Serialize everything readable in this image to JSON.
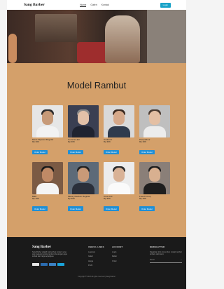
{
  "navbar": {
    "brand": "Sang Barber",
    "links": [
      "Home",
      "Galeri",
      "Kontak"
    ],
    "cta": "Login"
  },
  "models": {
    "title": "Model Rambut",
    "items": [
      {
        "name": "Mens Tapered Regular",
        "price": "Rp.30K",
        "button": "Order Model"
      },
      {
        "name": "Comma Hair",
        "price": "Rp.30K",
        "button": "Order Model"
      },
      {
        "name": "Undercut",
        "price": "Rp.30K",
        "button": "Order Model"
      },
      {
        "name": "Pompadour",
        "price": "Rp.30K",
        "button": "Order Model"
      },
      {
        "name": "Bald",
        "price": "Rp.30K",
        "button": "Order Model"
      },
      {
        "name": "Messy Medium Regular",
        "price": "Rp.30K",
        "button": "Order Model"
      },
      {
        "name": "Crew Cut",
        "price": "Rp.30K",
        "button": "Order Model"
      },
      {
        "name": "French Crop",
        "price": "Rp.30K",
        "button": "Order Model"
      }
    ]
  },
  "footer": {
    "brand": "Sang Barber",
    "description": "Sang Barber adalah barbershop modern yang siap melayani potong rambut pria dengan gaya terbaik dan harga terjangkau.",
    "useful_links": {
      "heading": "USEFUL LINKS",
      "items": [
        "Layanan",
        "Galeri",
        "Harga",
        "Profil"
      ]
    },
    "account": {
      "heading": "ACCOUNT",
      "items": [
        "Login",
        "Daftar",
        "Order"
      ]
    },
    "newsletter": {
      "heading": "NEWSLETTER",
      "text": "Dapatkan info promo dan model rambut terbaru dari kami.",
      "placeholder": "Email",
      "submit": "→"
    },
    "copyright": "Copyright © 2023 All rights reserved | Sang Barber"
  }
}
